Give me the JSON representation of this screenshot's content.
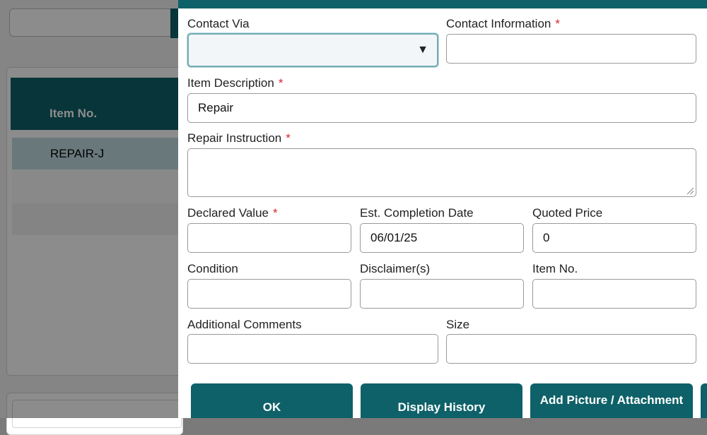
{
  "background": {
    "table_header_item_no": "Item No.",
    "row1_item_no": "REPAIR-J"
  },
  "modal": {
    "contact_via": {
      "label": "Contact Via",
      "value": "",
      "icon": "caret-down-icon"
    },
    "contact_information": {
      "label": "Contact Information",
      "required": "*",
      "value": ""
    },
    "item_description": {
      "label": "Item Description",
      "required": "*",
      "value": "Repair"
    },
    "repair_instruction": {
      "label": "Repair Instruction",
      "required": "*",
      "value": ""
    },
    "declared_value": {
      "label": "Declared Value",
      "required": "*",
      "value": ""
    },
    "est_completion_date": {
      "label": "Est. Completion Date",
      "value": "06/01/25"
    },
    "quoted_price": {
      "label": "Quoted Price",
      "value": "0"
    },
    "condition": {
      "label": "Condition",
      "value": ""
    },
    "disclaimers": {
      "label": "Disclaimer(s)",
      "value": ""
    },
    "item_no": {
      "label": "Item No.",
      "value": ""
    },
    "additional_comments": {
      "label": "Additional Comments",
      "value": ""
    },
    "size": {
      "label": "Size",
      "value": ""
    },
    "buttons": {
      "ok": "OK",
      "display_history": "Display History",
      "add_picture": "Add Picture / Attachment"
    }
  },
  "colors": {
    "accent": "#0e6168",
    "required": "#d9262c",
    "focus_border": "#72acb3"
  }
}
